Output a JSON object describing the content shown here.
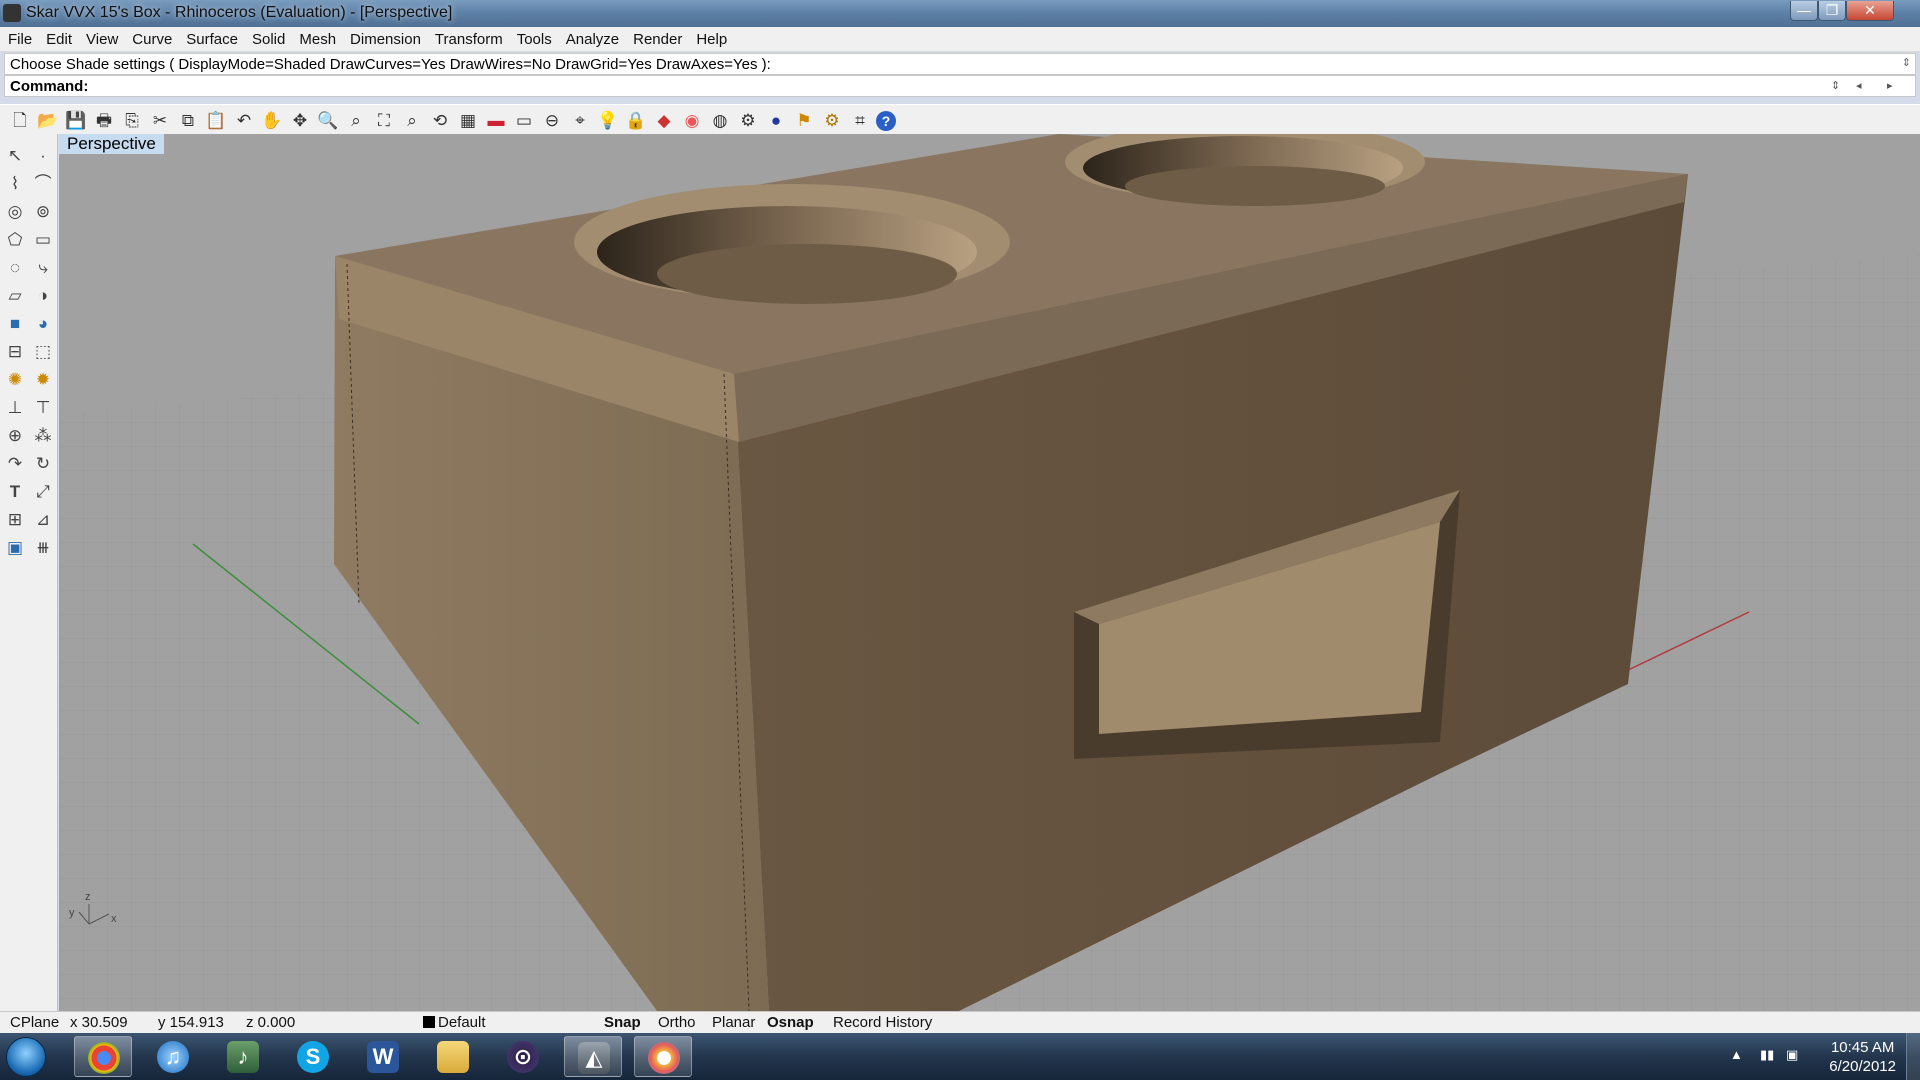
{
  "window": {
    "title": "Skar VVX 15's Box - Rhinoceros (Evaluation) - [Perspective]",
    "minimize": "—",
    "maximize": "❐",
    "close": "✕"
  },
  "menu": [
    "File",
    "Edit",
    "View",
    "Curve",
    "Surface",
    "Solid",
    "Mesh",
    "Dimension",
    "Transform",
    "Tools",
    "Analyze",
    "Render",
    "Help"
  ],
  "command": {
    "history": "Choose Shade settings ( DisplayMode=Shaded  DrawCurves=Yes  DrawWires=No  DrawGrid=Yes  DrawAxes=Yes ):",
    "prompt_label": "Command:"
  },
  "viewport": {
    "label": "Perspective",
    "axis_labels": {
      "x": "x",
      "y": "y",
      "z": "z"
    }
  },
  "status": {
    "cplane": "CPlane",
    "x": "x 30.509",
    "y": "y 154.913",
    "z": "z 0.000",
    "layer": "Default",
    "snap": "Snap",
    "ortho": "Ortho",
    "planar": "Planar",
    "osnap": "Osnap",
    "record_history": "Record History"
  },
  "taskbar": {
    "time": "10:45 AM",
    "date": "6/20/2012",
    "apps": [
      "chrome",
      "itunes",
      "music-app",
      "skype",
      "word",
      "explorer",
      "daw-app",
      "rhino",
      "paint"
    ]
  },
  "icons": {
    "new": "🗋",
    "open": "📂",
    "save": "💾",
    "print": "🖶",
    "cut": "✂",
    "copy": "⧉",
    "paste": "📋",
    "undo": "↶",
    "pan": "✋",
    "rotate": "✥",
    "zoom": "🔍",
    "grid": "▦",
    "car": "🚗",
    "light": "💡",
    "lock": "🔒",
    "help": "?"
  }
}
